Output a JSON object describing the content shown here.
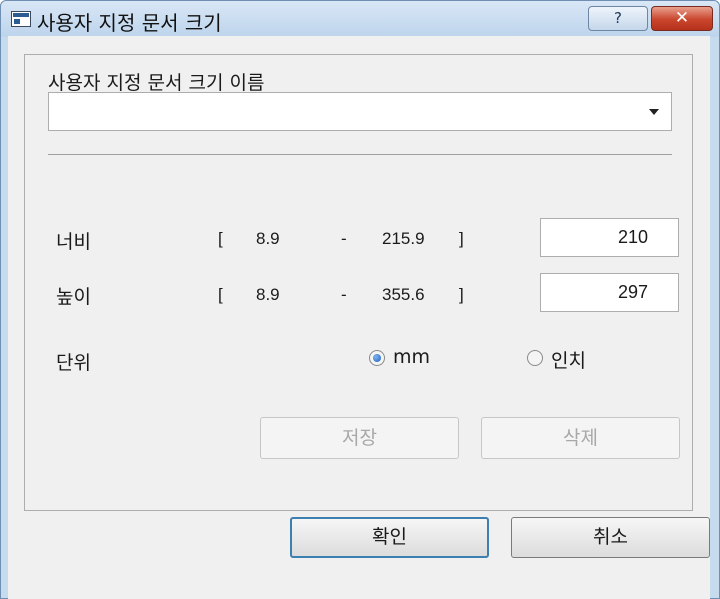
{
  "window": {
    "title": "사용자 지정 문서 크기",
    "help_label": "?",
    "close_label": "✕"
  },
  "form": {
    "name_label": "사용자 지정 문서 크기 이름",
    "name_value": "",
    "width": {
      "label": "너비",
      "open": "[",
      "min": "8.9",
      "dash": "-",
      "max": "215.9",
      "close": "]",
      "value": "210"
    },
    "height": {
      "label": "높이",
      "open": "[",
      "min": "8.9",
      "dash": "-",
      "max": "355.6",
      "close": "]",
      "value": "297"
    },
    "unit": {
      "label": "단위",
      "options": [
        {
          "label": "mm",
          "selected": true
        },
        {
          "label": "인치",
          "selected": false
        }
      ]
    },
    "save_label": "저장",
    "delete_label": "삭제"
  },
  "footer": {
    "ok_label": "확인",
    "cancel_label": "취소"
  },
  "colors": {
    "accent_border": "#3c7fb1",
    "close_button": "#c9452c",
    "title_bar": "#c7dbef"
  }
}
